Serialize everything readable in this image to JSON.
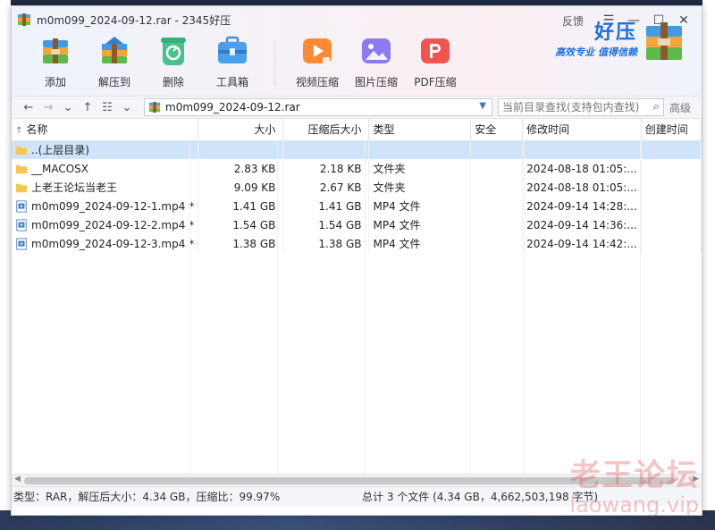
{
  "window": {
    "title": "m0m099_2024-09-12.rar - 2345好压",
    "feedback_label": "反馈"
  },
  "toolbar": {
    "tools": [
      {
        "label": "添加",
        "icon": "add-archive-icon"
      },
      {
        "label": "解压到",
        "icon": "extract-icon"
      },
      {
        "label": "删除",
        "icon": "delete-recycle-icon"
      },
      {
        "label": "工具箱",
        "icon": "toolbox-icon"
      },
      {
        "label": "视频压缩",
        "icon": "video-compress-icon"
      },
      {
        "label": "图片压缩",
        "icon": "image-compress-icon"
      },
      {
        "label": "PDF压缩",
        "icon": "pdf-compress-icon"
      }
    ],
    "brand_title": "好压",
    "brand_slogan": "高效专业  值得信赖"
  },
  "navbar": {
    "path": "m0m099_2024-09-12.rar",
    "search_placeholder": "当前目录查找(支持包内查找)",
    "advanced_label": "高级"
  },
  "table": {
    "columns": [
      "名称",
      "大小",
      "压缩后大小",
      "类型",
      "安全",
      "修改时间",
      "创建时间"
    ],
    "rows": [
      {
        "name": "..(上层目录)",
        "size": "",
        "packed": "",
        "type": "",
        "security": "",
        "modified": "",
        "created": "",
        "kind": "folder",
        "selected": true
      },
      {
        "name": "__MACOSX",
        "size": "2.83 KB",
        "packed": "2.18 KB",
        "type": "文件夹",
        "security": "",
        "modified": "2024-08-18 01:05:...",
        "created": "",
        "kind": "folder",
        "selected": false
      },
      {
        "name": "上老王论坛当老王",
        "size": "9.09 KB",
        "packed": "2.67 KB",
        "type": "文件夹",
        "security": "",
        "modified": "2024-08-18 01:05:...",
        "created": "",
        "kind": "folder",
        "selected": false
      },
      {
        "name": "m0m099_2024-09-12-1.mp4 *",
        "size": "1.41 GB",
        "packed": "1.41 GB",
        "type": "MP4 文件",
        "security": "",
        "modified": "2024-09-14 14:28:...",
        "created": "",
        "kind": "video",
        "selected": false
      },
      {
        "name": "m0m099_2024-09-12-2.mp4 *",
        "size": "1.54 GB",
        "packed": "1.54 GB",
        "type": "MP4 文件",
        "security": "",
        "modified": "2024-09-14 14:36:...",
        "created": "",
        "kind": "video",
        "selected": false
      },
      {
        "name": "m0m099_2024-09-12-3.mp4 *",
        "size": "1.38 GB",
        "packed": "1.38 GB",
        "type": "MP4 文件",
        "security": "",
        "modified": "2024-09-14 14:42:...",
        "created": "",
        "kind": "video",
        "selected": false
      }
    ]
  },
  "status": {
    "left": "类型：RAR，解压后大小：4.34 GB，压缩比：99.97%",
    "right": "总计 3 个文件 (4.34 GB，4,662,503,198 字节)"
  },
  "watermark": {
    "line1": "老王论坛",
    "line2": "laowang.vip"
  },
  "colors": {
    "accent": "#1e6fe0",
    "selection": "#cfe3fb",
    "folder": "#f5c84c"
  }
}
